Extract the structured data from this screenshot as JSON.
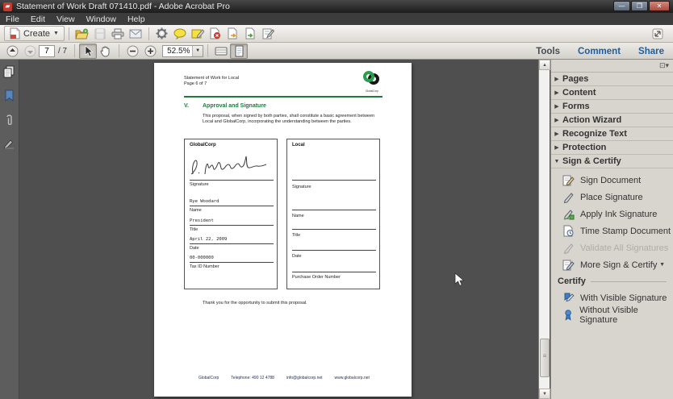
{
  "window": {
    "title": "Statement of Work Draft 071410.pdf - Adobe Acrobat Pro",
    "controls": {
      "minimize": "—",
      "maximize": "❐",
      "close": "✕"
    }
  },
  "menu": {
    "items": [
      "File",
      "Edit",
      "View",
      "Window",
      "Help"
    ]
  },
  "toolbar": {
    "create_label": "Create",
    "icon_names": [
      "open-file-icon",
      "save-icon",
      "print-icon",
      "email-icon",
      "gear-icon",
      "comment-bubble-icon",
      "sticky-note-icon",
      "pdf-remove-icon",
      "pdf-export-icon",
      "pdf-attach-icon",
      "edit-form-icon",
      "expand-toolbar-icon"
    ],
    "page_current": "7",
    "page_total": "/ 7",
    "zoom_value": "52.5%",
    "zoom_caret": "▼",
    "up_arrow": "▲",
    "down_arrow": "▼"
  },
  "taskbar": {
    "tabs": [
      {
        "label": "Tools"
      },
      {
        "label": "Comment"
      },
      {
        "label": "Share"
      }
    ]
  },
  "sidebar": {
    "minibar_icon": "⊡▾",
    "collapsed_arrow": "▶",
    "expanded_arrow": "▼",
    "panels": [
      {
        "label": "Pages"
      },
      {
        "label": "Content"
      },
      {
        "label": "Forms"
      },
      {
        "label": "Action Wizard"
      },
      {
        "label": "Recognize Text"
      },
      {
        "label": "Protection"
      }
    ],
    "sign_panel": {
      "label": "Sign & Certify",
      "items": [
        {
          "label": "Sign Document"
        },
        {
          "label": "Place Signature"
        },
        {
          "label": "Apply Ink Signature"
        },
        {
          "label": "Time Stamp Document"
        },
        {
          "label": "Validate All Signatures"
        },
        {
          "label": "More Sign & Certify"
        }
      ]
    },
    "certify": {
      "header": "Certify",
      "items": [
        {
          "label": "With Visible Signature"
        },
        {
          "label": "Without Visible Signature"
        }
      ]
    }
  },
  "document": {
    "header_line1": "Statement of Work for Local",
    "header_line2": "Page 6 of 7",
    "logo_text": "GlobalCorp",
    "section_number": "V.",
    "section_title": "Approval and Signature",
    "body": "This proposal, when signed by both parties, shall constitute a basic agreement between Local and GlobalCorp, incorporating the understanding between the parties.",
    "left_box": {
      "title": "GlobalCorp",
      "signature_script_name": "R. Woodard",
      "labels": [
        "Signature",
        "Name",
        "Title",
        "Date",
        "Tax ID Number"
      ],
      "values": [
        "Rye Woodard",
        "President",
        "April 22, 2009",
        "00-000000"
      ]
    },
    "right_box": {
      "title": "Local",
      "labels": [
        "Signature",
        "Name",
        "Title",
        "Date",
        "Purchase Order Number"
      ]
    },
    "thanks": "Thank you for the opportunity to submit this proposal.",
    "footer": {
      "company": "GlobalCorp",
      "phone": "Telephone: 490 12 4788",
      "email": "info@globalcorp.net",
      "web": "www.globalcorp.net"
    }
  },
  "colors": {
    "accent_green": "#1f7a3d",
    "link_blue": "#1d5c9e",
    "doc_bg": "#4f4f4f",
    "sidebar_bg": "#d8d4ce"
  }
}
